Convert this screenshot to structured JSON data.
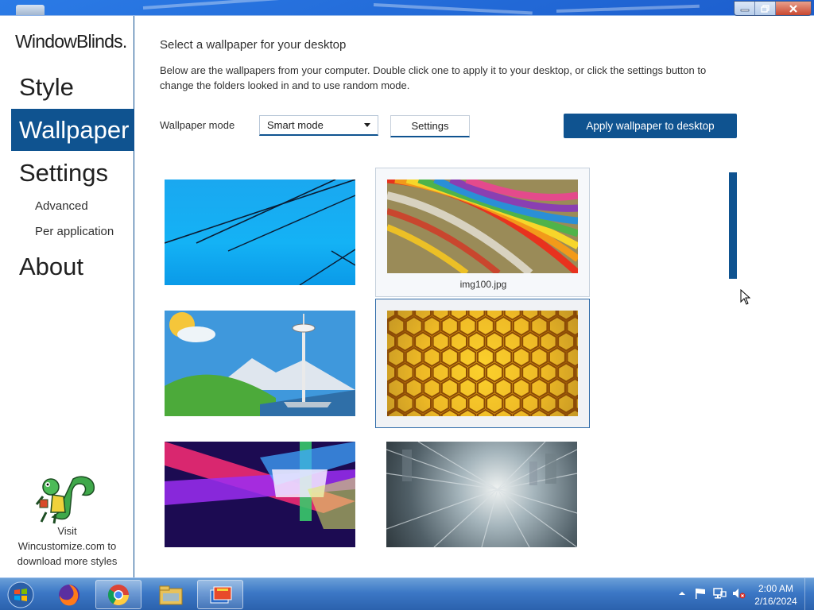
{
  "window": {
    "caption": {
      "minimize_icon": "minimize-icon",
      "maximize_icon": "restore-icon",
      "close_icon": "close-icon"
    }
  },
  "sidebar": {
    "brand": "WindowBlinds.",
    "nav": [
      {
        "label": "Style",
        "active": false
      },
      {
        "label": "Wallpaper",
        "active": true
      },
      {
        "label": "Settings",
        "active": false
      },
      {
        "label": "About",
        "active": false
      }
    ],
    "sub_items": [
      "Advanced",
      "Per application"
    ],
    "visit_lines": [
      "Visit",
      "Wincustomize.com to",
      "download more styles"
    ]
  },
  "main": {
    "title": "Select a wallpaper for your desktop",
    "description": "Below are the wallpapers from your computer.  Double click one to apply it to your desktop, or click the settings button to change the folders looked in and to use random mode.",
    "mode_label": "Wallpaper mode",
    "mode_value": "Smart mode",
    "settings_label": "Settings",
    "apply_label": "Apply wallpaper to desktop",
    "thumbnails": [
      {
        "name": "blue-lines",
        "caption": ""
      },
      {
        "name": "colored-paper",
        "caption": "img100.jpg"
      },
      {
        "name": "space-needle",
        "caption": ""
      },
      {
        "name": "honeycomb",
        "caption": ""
      },
      {
        "name": "light-beams",
        "caption": ""
      },
      {
        "name": "train-motion",
        "caption": ""
      }
    ]
  },
  "taskbar": {
    "apps": [
      "windows-start-icon",
      "firefox-icon",
      "chrome-icon",
      "file-explorer-icon",
      "windowblinds-icon"
    ],
    "tray": [
      "show-hidden-icons-icon",
      "action-center-flag-icon",
      "network-icon",
      "volume-muted-icon"
    ],
    "time": "2:00 AM",
    "date": "2/16/2024"
  },
  "colors": {
    "accent": "#0f5390",
    "text": "#303030",
    "taskbar": "#3c78c6"
  }
}
